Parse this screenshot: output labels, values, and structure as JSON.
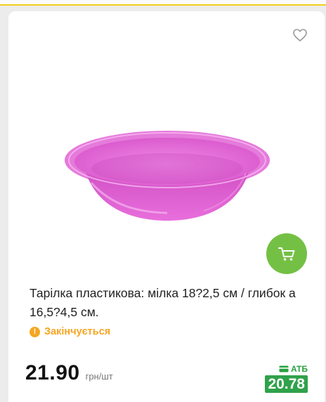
{
  "product": {
    "title": "Тарілка пластикова: мілка 18?2,5 см / глибок а 16,5?4,5 см.",
    "status": "Закінчується",
    "price": "21.90",
    "price_unit": "грн/шт",
    "promo": {
      "label": "АТБ",
      "price": "20.78"
    }
  },
  "icons": {
    "favorite": "heart-outline-icon",
    "cart": "cart-icon",
    "status": "warning-icon",
    "promo_card": "card-icon"
  },
  "colors": {
    "accent_yellow": "#f5cf1f",
    "cart_green": "#74c045",
    "status_orange": "#f5a623",
    "promo_green": "#2fa24a",
    "bowl_pink": "#e466d8"
  }
}
